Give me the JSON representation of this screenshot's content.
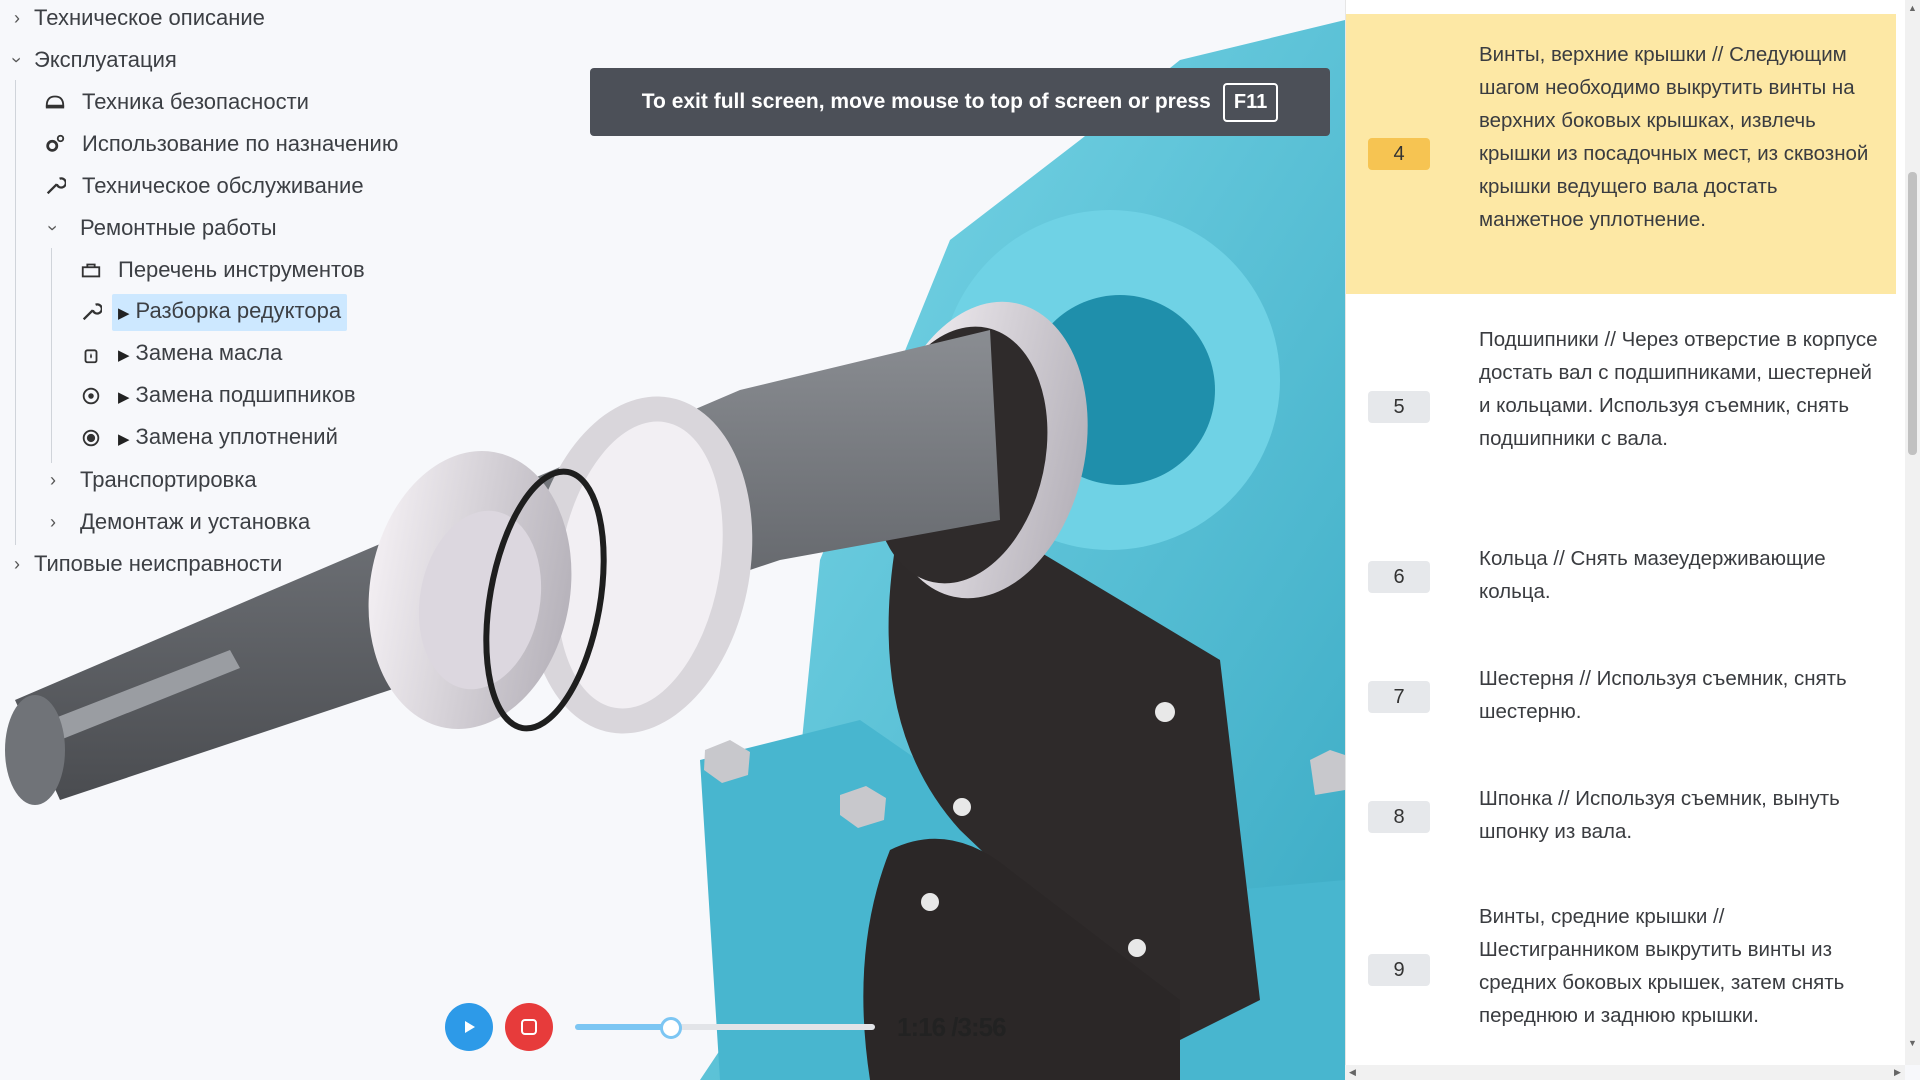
{
  "tree": {
    "items": [
      {
        "label": "Техническое описание"
      },
      {
        "label": "Эксплуатация"
      },
      {
        "label": "Техника безопасности"
      },
      {
        "label": "Использование по назначению"
      },
      {
        "label": "Техническое обслуживание"
      },
      {
        "label": "Ремонтные работы"
      },
      {
        "label": "Перечень инструментов"
      },
      {
        "label": "Разборка редуктора"
      },
      {
        "label": "Замена масла"
      },
      {
        "label": "Замена подшипников"
      },
      {
        "label": "Замена уплотнений"
      },
      {
        "label": "Транспортировка"
      },
      {
        "label": "Демонтаж и установка"
      },
      {
        "label": "Типовые неисправности"
      }
    ],
    "selected": "Разборка редуктора"
  },
  "toast": {
    "message": "To exit full screen, move mouse to top of screen or press",
    "key": "F11"
  },
  "player": {
    "time": "1:16 /3:56",
    "progress": 0.32
  },
  "steps": [
    {
      "number": "4",
      "text": "Винты, верхние крышки // Следующим шагом необходимо выкрутить винты на верхних боковых крышках, извлечь крышки из посадочных мест, из сквозной крышки ведущего вала достать манжетное уплотнение.",
      "active": true
    },
    {
      "number": "5",
      "text": "Подшипники // Через отверстие в корпусе достать вал с подшипниками, шестерней и кольцами. Используя съемник, снять подшипники с вала.",
      "active": false
    },
    {
      "number": "6",
      "text": "Кольца // Снять мазеудерживающие кольца.",
      "active": false
    },
    {
      "number": "7",
      "text": "Шестерня // Используя съемник, снять шестерню.",
      "active": false
    },
    {
      "number": "8",
      "text": "Шпонка // Используя съемник, вынуть шпонку из вала.",
      "active": false
    },
    {
      "number": "9",
      "text": "Винты, средние крышки // Шестигранником выкрутить винты из средних боковых крышек, затем снять переднюю и заднюю крышки.",
      "active": false
    }
  ],
  "colors": {
    "housing": "#5ec8dc",
    "active_step": "#fde8a5",
    "active_badge": "#f6c452",
    "selection": "#cde8ff",
    "play_button": "#2d9ae8",
    "stop_button": "#e73b3b"
  }
}
